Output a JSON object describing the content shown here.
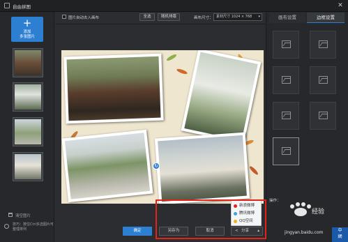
{
  "window": {
    "title": "自由拼图",
    "close_glyph": "✕"
  },
  "left_panel": {
    "add_button": {
      "icon": "plus-icon",
      "glyph": "+",
      "label_line1": "添加",
      "label_line2": "多张图片"
    },
    "clear_label": "清空图片",
    "tip_text": "技巧：按住Ctrl多选图片可整理排列"
  },
  "toolbar": {
    "auto_fill_label": "图片自动去入画布",
    "auto_fill_checked": false,
    "select_all_label": "全选",
    "random_layout_label": "随机排版",
    "canvas_size_label": "画布尺寸：",
    "canvas_size_value": "素材尺寸 1024 × 768"
  },
  "right_panel": {
    "tabs": [
      {
        "label": "画布设置",
        "active": false
      },
      {
        "label": "边框设置",
        "active": true
      }
    ],
    "frame_options_count": 8,
    "operation_label": "操作："
  },
  "bottom": {
    "confirm_label": "确定",
    "save_as_label": "另存为",
    "cancel_label": "取消",
    "share_label": "分享",
    "share_menu": [
      {
        "label": "新浪微博",
        "color": "#e2231a",
        "icon": "weibo-icon"
      },
      {
        "label": "腾讯微博",
        "color": "#3aa7d8",
        "icon": "tencent-weibo-icon"
      },
      {
        "label": "QQ空间",
        "color": "#f2b21b",
        "icon": "qzone-icon"
      }
    ]
  },
  "watermark": {
    "text": "jingyan.baidu.com",
    "badge_line1": "中",
    "badge_line2": "網"
  },
  "colors": {
    "accent": "#2d7fd2",
    "highlight_box": "#e2231a",
    "canvas_bg": "#efe6cf"
  }
}
